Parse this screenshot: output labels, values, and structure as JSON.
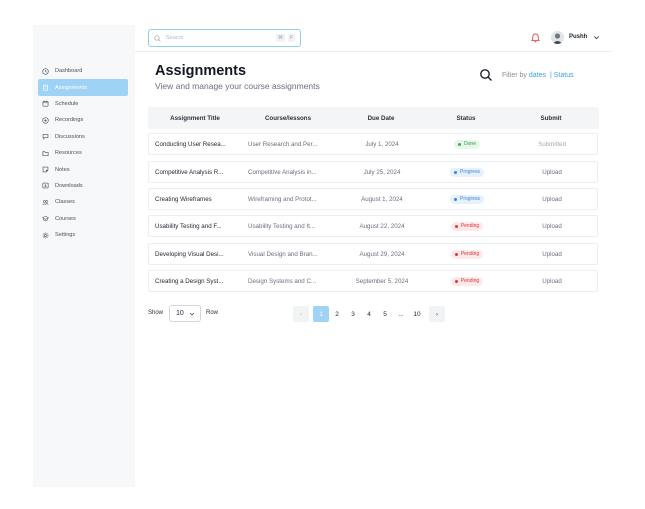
{
  "sidebar": {
    "items": [
      {
        "label": "Dashboard",
        "icon": "clock-icon"
      },
      {
        "label": "Assignments",
        "icon": "clipboard-icon",
        "active": true
      },
      {
        "label": "Schedule",
        "icon": "calendar-icon"
      },
      {
        "label": "Recordings",
        "icon": "video-icon"
      },
      {
        "label": "Discussions",
        "icon": "chat-icon"
      },
      {
        "label": "Resources",
        "icon": "folder-icon"
      },
      {
        "label": "Notes",
        "icon": "note-icon"
      },
      {
        "label": "Downloads",
        "icon": "download-icon"
      },
      {
        "label": "Classes",
        "icon": "users-icon"
      },
      {
        "label": "Courses",
        "icon": "graduation-icon"
      },
      {
        "label": "Settings",
        "icon": "gear-icon"
      }
    ]
  },
  "topbar": {
    "search_placeholder": "Search",
    "shortcut_keys": [
      "⌘",
      "F"
    ],
    "username": "Pushh"
  },
  "page": {
    "title": "Assignments",
    "subtitle": "View and manage your course assignments",
    "filter_prefix": "Filter by",
    "filter_dates": "dates",
    "filter_separator": "|",
    "filter_status": "Status"
  },
  "table": {
    "headers": [
      "Assignment Title",
      "Course/lessons",
      "Due Date",
      "Status",
      "Submit"
    ],
    "rows": [
      {
        "title": "Conducting User Resea...",
        "course": "User Research and Per...",
        "due": "July 1, 2024",
        "status": "Done",
        "status_type": "done",
        "submit": "Submitted",
        "submitted": true
      },
      {
        "title": "Competitive Analysis R...",
        "course": "Competitive Analysis in...",
        "due": "July 25, 2024",
        "status": "Progress",
        "status_type": "progress",
        "submit": "Upload",
        "submitted": false
      },
      {
        "title": "Creating Wireframes",
        "course": "Wireframing and Protot...",
        "due": "August 1, 2024",
        "status": "Progress",
        "status_type": "progress",
        "submit": "Upload",
        "submitted": false
      },
      {
        "title": "Usability Testing and F...",
        "course": "Usability Testing and It...",
        "due": "August 22, 2024",
        "status": "Pending",
        "status_type": "pending",
        "submit": "Upload",
        "submitted": false
      },
      {
        "title": "Developing Visual Desi...",
        "course": "Visual Design and Bran...",
        "due": "August 29, 2024",
        "status": "Pending",
        "status_type": "pending",
        "submit": "Upload",
        "submitted": false
      },
      {
        "title": "Creating a Design Syst...",
        "course": "Design Systems and C...",
        "due": "September 5, 2024",
        "status": "Pending",
        "status_type": "pending",
        "submit": "Upload",
        "submitted": false
      }
    ]
  },
  "footer": {
    "show_label": "Show",
    "rows_value": "10",
    "row_label": "Row",
    "pages": [
      "1",
      "2",
      "3",
      "4",
      "5",
      "...",
      "10"
    ],
    "active_page": "1",
    "prev_glyph": "‹",
    "next_glyph": "›"
  },
  "colors": {
    "accent": "#9fd3f5",
    "link": "#3b9fe0",
    "done": "#32b350",
    "progress": "#3a86d8",
    "pending": "#e0353d"
  }
}
